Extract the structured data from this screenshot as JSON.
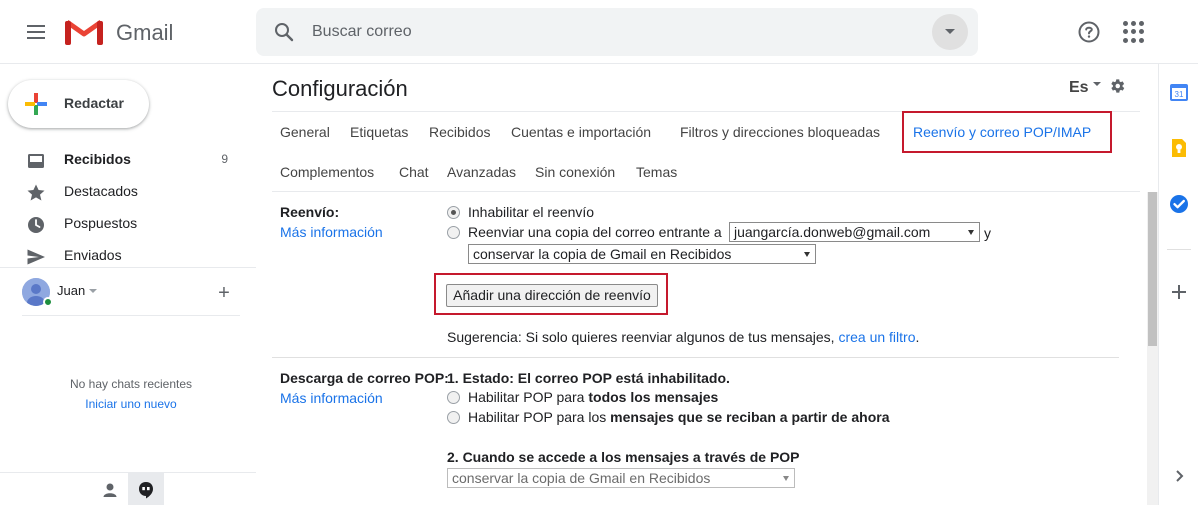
{
  "header": {
    "brand": "Gmail",
    "search_placeholder": "Buscar correo"
  },
  "sidebar": {
    "compose_label": "Redactar",
    "items": [
      {
        "label": "Recibidos",
        "count": "9"
      },
      {
        "label": "Destacados"
      },
      {
        "label": "Pospuestos"
      },
      {
        "label": "Enviados"
      }
    ],
    "user_name": "Juan",
    "no_chats": "No hay chats recientes",
    "start_new": "Iniciar uno nuevo"
  },
  "main": {
    "title": "Configuración",
    "lang": "Es",
    "tabs": [
      "General",
      "Etiquetas",
      "Recibidos",
      "Cuentas e importación",
      "Filtros y direcciones bloqueadas",
      "Reenvío y correo POP/IMAP",
      "Complementos",
      "Chat",
      "Avanzadas",
      "Sin conexión",
      "Temas"
    ],
    "active_tab": "Reenvío y correo POP/IMAP",
    "forwarding": {
      "label": "Reenvío:",
      "more_info": "Más información",
      "option_disable": "Inhabilitar el reenvío",
      "option_forward": "Reenviar una copia del correo entrante a",
      "forward_address": "juangarcía.donweb@gmail.com",
      "and_text": "y",
      "keep_option": "conservar la copia de Gmail en Recibidos",
      "add_button": "Añadir una dirección de reenvío",
      "tip_prefix": "Sugerencia: Si solo quieres reenviar algunos de tus mensajes,",
      "tip_link": "crea un filtro",
      "tip_suffix": "."
    },
    "pop": {
      "label": "Descarga de correo POP:",
      "more_info": "Más información",
      "status": "1. Estado: El correo POP está inhabilitado.",
      "enable_all_prefix": "Habilitar POP para",
      "enable_all_bold": "todos los mensajes",
      "enable_from_now_prefix": "Habilitar POP para los",
      "enable_from_now_bold": "mensajes que se reciban a partir de ahora",
      "when_accessed": "2. Cuando se accede a los mensajes a través de POP",
      "keep_option": "conservar la copia de Gmail en Recibidos"
    }
  },
  "colors": {
    "accent": "#1a73e8",
    "highlight": "#c5192d"
  }
}
